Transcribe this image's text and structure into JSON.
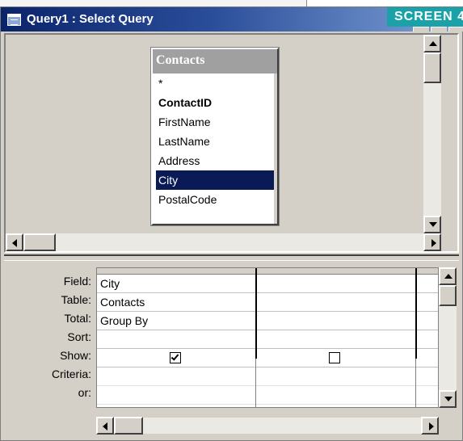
{
  "window": {
    "title": "Query1 : Select Query",
    "badge": "SCREEN 4"
  },
  "field_list": {
    "title": "Contacts",
    "items": [
      {
        "label": "*",
        "bold": false,
        "selected": false
      },
      {
        "label": "ContactID",
        "bold": true,
        "selected": false
      },
      {
        "label": "FirstName",
        "bold": false,
        "selected": false
      },
      {
        "label": "LastName",
        "bold": false,
        "selected": false
      },
      {
        "label": "Address",
        "bold": false,
        "selected": false
      },
      {
        "label": "City",
        "bold": false,
        "selected": true
      },
      {
        "label": "PostalCode",
        "bold": false,
        "selected": false
      }
    ]
  },
  "design_grid": {
    "row_labels": [
      "Field:",
      "Table:",
      "Total:",
      "Sort:",
      "Show:",
      "Criteria:",
      "or:"
    ],
    "columns": [
      {
        "field": "City",
        "table": "Contacts",
        "total": "Group By",
        "sort": "",
        "show": true,
        "criteria": "",
        "or": ""
      },
      {
        "field": "",
        "table": "",
        "total": "",
        "sort": "",
        "show": false,
        "criteria": "",
        "or": ""
      }
    ]
  },
  "colors": {
    "title_bar": "#0a246a",
    "badge": "#1aa2a8",
    "selection": "#0a1a56",
    "face": "#d4d0c8"
  },
  "icons": [
    "query-window-icon",
    "scroll-up-icon",
    "scroll-down-icon",
    "scroll-left-icon",
    "scroll-right-icon",
    "checkbox-icon"
  ]
}
